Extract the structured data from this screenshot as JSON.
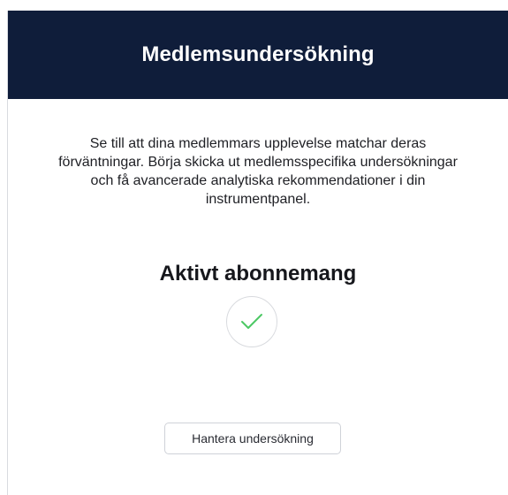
{
  "header": {
    "title": "Medlemsundersökning",
    "background_color": "#0f1d3a"
  },
  "body": {
    "description": "Se till att dina medlemmars upplevelse matchar deras förväntningar. Börja skicka ut medlemsspecifika undersökningar och få avancerade analytiska rekommendationer i din instrumentpanel.",
    "status_heading": "Aktivt abonnemang",
    "status_icon": "check-icon",
    "status_icon_color": "#4cc864"
  },
  "actions": {
    "manage_label": "Hantera undersökning"
  }
}
